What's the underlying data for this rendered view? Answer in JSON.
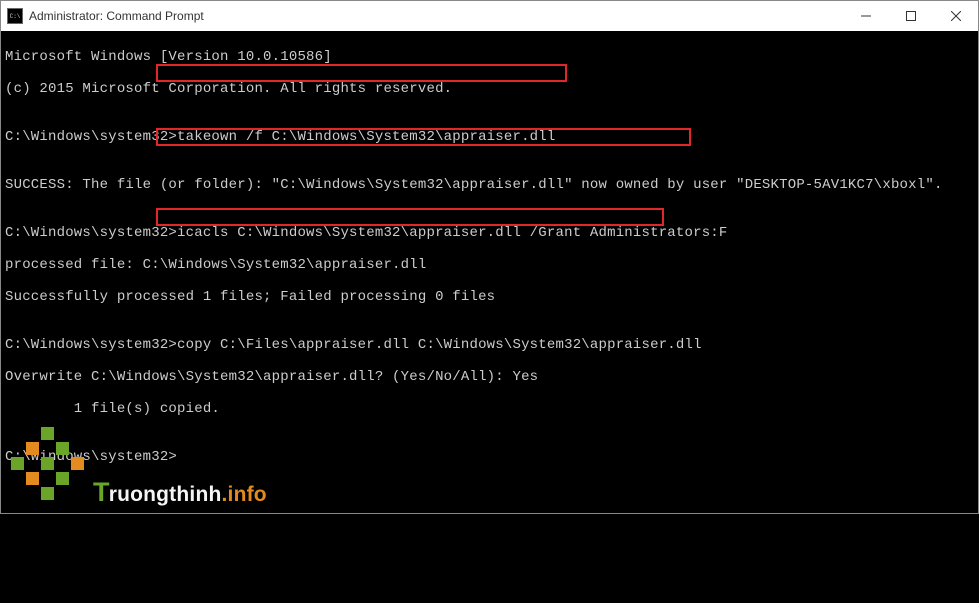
{
  "titlebar": {
    "title": "Administrator: Command Prompt"
  },
  "terminal": {
    "lines": {
      "l1": "Microsoft Windows [Version 10.0.10586]",
      "l2": "(c) 2015 Microsoft Corporation. All rights reserved.",
      "l3": "",
      "l4": "C:\\Windows\\system32>takeown /f C:\\Windows\\System32\\appraiser.dll",
      "l5": "",
      "l6": "SUCCESS: The file (or folder): \"C:\\Windows\\System32\\appraiser.dll\" now owned by user \"DESKTOP-5AV1KC7\\xboxl\".",
      "l7": "",
      "l8": "C:\\Windows\\system32>icacls C:\\Windows\\System32\\appraiser.dll /Grant Administrators:F",
      "l9": "processed file: C:\\Windows\\System32\\appraiser.dll",
      "l10": "Successfully processed 1 files; Failed processing 0 files",
      "l11": "",
      "l12": "C:\\Windows\\system32>copy C:\\Files\\appraiser.dll C:\\Windows\\System32\\appraiser.dll",
      "l13": "Overwrite C:\\Windows\\System32\\appraiser.dll? (Yes/No/All): Yes",
      "l14": "        1 file(s) copied.",
      "l15": "",
      "l16": "C:\\Windows\\system32>"
    }
  },
  "watermark": {
    "name_t": "T",
    "name_rest": "ruongthinh",
    "domain": ".info"
  }
}
